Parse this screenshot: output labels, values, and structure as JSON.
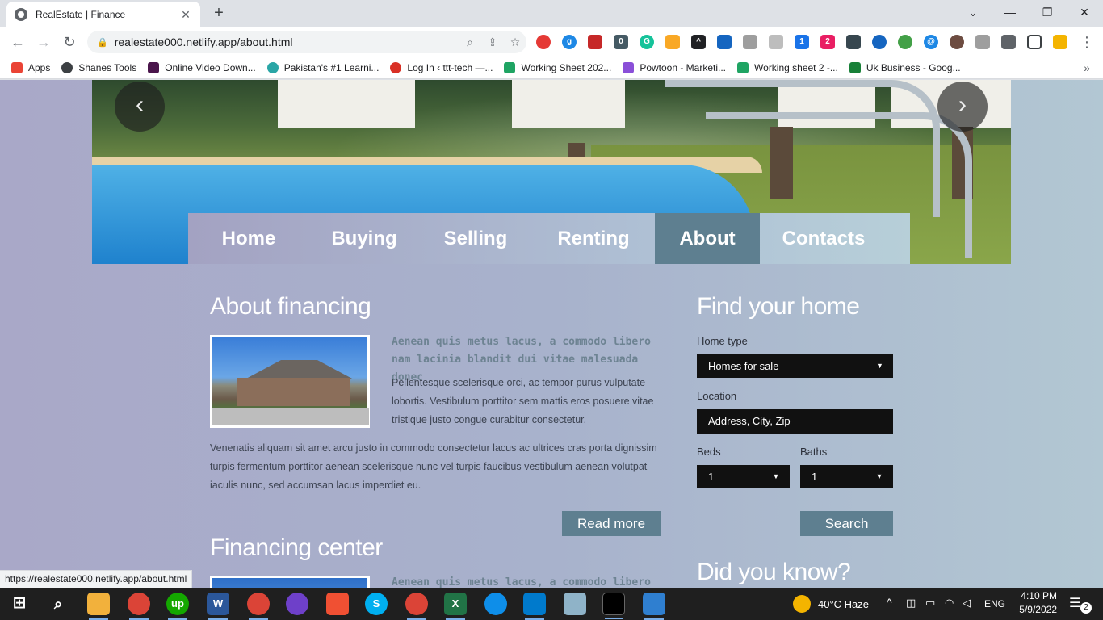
{
  "browser": {
    "tab_title": "RealEstate | Finance",
    "tab_close": "✕",
    "new_tab": "+",
    "window_controls": [
      "⌄",
      "—",
      "❐",
      "✕"
    ],
    "back": "←",
    "forward": "→",
    "reload": "↻",
    "url": "realestate000.netlify.app/about.html",
    "omnibox_icons": [
      "⌕",
      "⇪",
      "☆"
    ],
    "menu": "⋮"
  },
  "bookmarks": {
    "items": [
      {
        "label": "Apps",
        "color": "#ea4335"
      },
      {
        "label": "Shanes Tools",
        "color": "#3c4043"
      },
      {
        "label": "Online Video Down...",
        "color": "#4a154b"
      },
      {
        "label": "Pakistan's #1 Learni...",
        "color": "#2aa6a6"
      },
      {
        "label": "Log In ‹ ttt-tech —...",
        "color": "#d93025"
      },
      {
        "label": "Working Sheet 202...",
        "color": "#1fa463"
      },
      {
        "label": "Powtoon - Marketi...",
        "color": "#8a4fd8"
      },
      {
        "label": "Working sheet 2 -...",
        "color": "#1fa463"
      },
      {
        "label": "Uk Business - Goog...",
        "color": "#188038"
      }
    ],
    "more": "»"
  },
  "site": {
    "nav": [
      {
        "label": "Home",
        "active": false
      },
      {
        "label": "Buying",
        "active": false
      },
      {
        "label": "Selling",
        "active": false
      },
      {
        "label": "Renting",
        "active": false
      },
      {
        "label": "About",
        "active": true
      },
      {
        "label": "Contacts",
        "active": false
      }
    ],
    "slider_prev": "‹",
    "slider_next": "›",
    "about": {
      "title": "About financing",
      "subtitle": "Aenean quis metus lacus, a commodo libero nam lacinia blandit dui vitae malesuada donec",
      "intro": "Pellentesque scelerisque orci, ac tempor purus vulputate lobortis. Vestibulum porttitor sem mattis eros posuere vitae tristique justo congue curabitur consectetur.",
      "body": "Venenatis aliquam sit amet arcu justo in commodo consectetur lacus ac ultrices cras porta dignissim turpis fermentum porttitor aenean scelerisque nunc vel turpis faucibus vestibulum aenean volutpat iaculis nunc, sed accumsan lacus imperdiet eu.",
      "read_more": "Read more"
    },
    "financing": {
      "title": "Financing center",
      "subtitle": "Aenean quis metus lacus, a commodo libero"
    },
    "search": {
      "title": "Find your home",
      "home_type_label": "Home type",
      "home_type_value": "Homes for sale",
      "location_label": "Location",
      "location_placeholder": "Address, City, Zip",
      "beds_label": "Beds",
      "beds_value": "1",
      "baths_label": "Baths",
      "baths_value": "1",
      "search_button": "Search"
    },
    "did_you_know": "Did you know?"
  },
  "status_url": "https://realestate000.netlify.app/about.html",
  "taskbar": {
    "weather": "40°C  Haze",
    "lang": "ENG",
    "time": "4:10 PM",
    "date": "5/9/2022",
    "notifications": "2"
  }
}
